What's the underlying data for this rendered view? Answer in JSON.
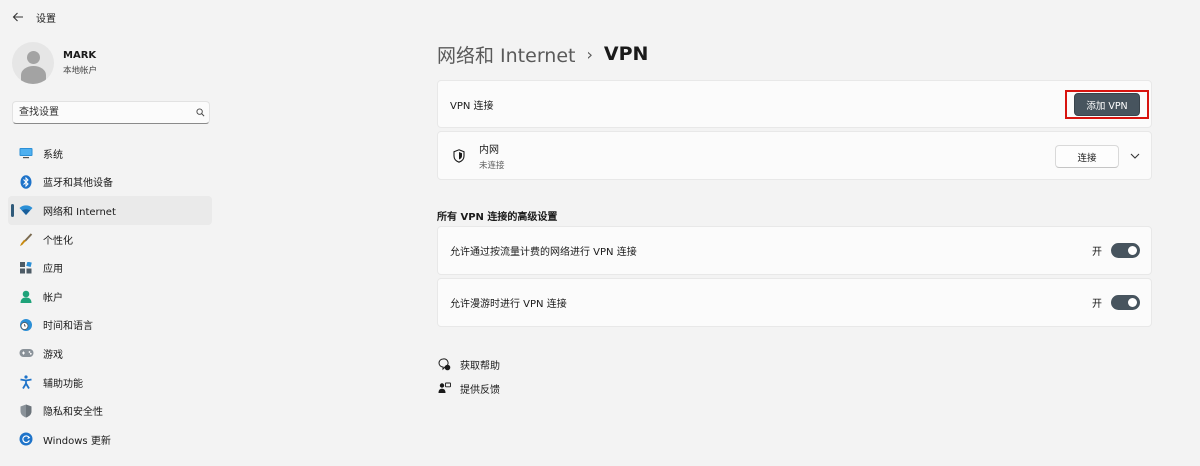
{
  "app": {
    "title": "设置",
    "back_icon": "back-arrow-icon"
  },
  "profile": {
    "name": "MARK",
    "subtitle": "本地帐户"
  },
  "search": {
    "placeholder": "查找设置",
    "icon": "search-icon"
  },
  "sidebar": {
    "items": [
      {
        "label": "系统",
        "icon": "monitor-icon",
        "active": false
      },
      {
        "label": "蓝牙和其他设备",
        "icon": "bluetooth-icon",
        "active": false
      },
      {
        "label": "网络和 Internet",
        "icon": "wifi-icon",
        "active": true
      },
      {
        "label": "个性化",
        "icon": "brush-icon",
        "active": false
      },
      {
        "label": "应用",
        "icon": "apps-icon",
        "active": false
      },
      {
        "label": "帐户",
        "icon": "account-icon",
        "active": false
      },
      {
        "label": "时间和语言",
        "icon": "clock-globe-icon",
        "active": false
      },
      {
        "label": "游戏",
        "icon": "gamepad-icon",
        "active": false
      },
      {
        "label": "辅助功能",
        "icon": "accessibility-icon",
        "active": false
      },
      {
        "label": "隐私和安全性",
        "icon": "shield-icon",
        "active": false
      },
      {
        "label": "Windows 更新",
        "icon": "update-icon",
        "active": false
      }
    ]
  },
  "breadcrumb": {
    "parent": "网络和 Internet",
    "separator": "›",
    "current": "VPN"
  },
  "vpn_connections": {
    "label": "VPN 连接",
    "add_button": "添加 VPN"
  },
  "vpn_entry": {
    "name": "内网",
    "status": "未连接",
    "connect_button": "连接",
    "icon": "vpn-shield-icon"
  },
  "advanced": {
    "title": "所有 VPN 连接的高级设置",
    "settings": [
      {
        "label": "允许通过按流量计费的网络进行 VPN 连接",
        "state_text": "开",
        "on": true
      },
      {
        "label": "允许漫游时进行 VPN 连接",
        "state_text": "开",
        "on": true
      }
    ]
  },
  "help_links": [
    {
      "label": "获取帮助",
      "icon": "help-icon"
    },
    {
      "label": "提供反馈",
      "icon": "feedback-icon"
    }
  ],
  "colors": {
    "accent": "#47545e",
    "highlight_border": "#d8140f",
    "background": "#f3f3f3"
  }
}
